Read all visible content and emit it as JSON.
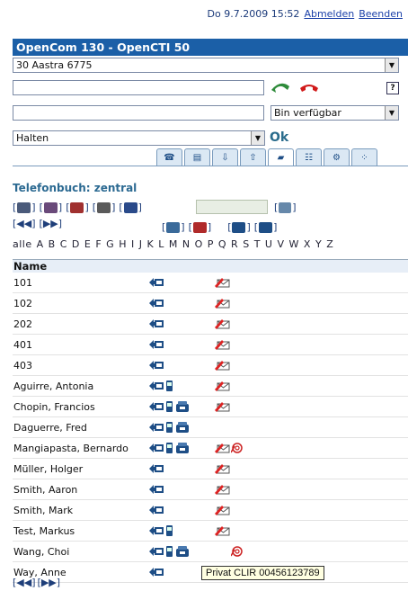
{
  "header": {
    "datetime": "Do 9.7.2009 15:52",
    "logout_label": "Abmelden",
    "exit_label": "Beenden"
  },
  "title": "OpenCom 130 - OpenCTI 50",
  "device_select": "30 Aastra 6775",
  "dial_input": "",
  "status_input": "",
  "status_select": "Bin verfügbar",
  "action_select": "Halten",
  "ok_label": "Ok",
  "phonebook_title": "Telefonbuch: zentral",
  "alphabet": [
    "alle",
    "A",
    "B",
    "C",
    "D",
    "E",
    "F",
    "G",
    "H",
    "I",
    "J",
    "K",
    "L",
    "M",
    "N",
    "O",
    "P",
    "Q",
    "R",
    "S",
    "T",
    "U",
    "V",
    "W",
    "X",
    "Y",
    "Z"
  ],
  "table_header": "Name",
  "rows": [
    {
      "name": "101",
      "card": true,
      "mobile": false,
      "desk": false,
      "mail": true,
      "at": false
    },
    {
      "name": "102",
      "card": true,
      "mobile": false,
      "desk": false,
      "mail": true,
      "at": false
    },
    {
      "name": "202",
      "card": true,
      "mobile": false,
      "desk": false,
      "mail": true,
      "at": false
    },
    {
      "name": "401",
      "card": true,
      "mobile": false,
      "desk": false,
      "mail": true,
      "at": false
    },
    {
      "name": "403",
      "card": true,
      "mobile": false,
      "desk": false,
      "mail": true,
      "at": false
    },
    {
      "name": "Aguirre, Antonia",
      "card": true,
      "mobile": true,
      "desk": false,
      "mail": true,
      "at": false
    },
    {
      "name": "Chopin, Francios",
      "card": true,
      "mobile": true,
      "desk": true,
      "mail": true,
      "at": false
    },
    {
      "name": "Daguerre, Fred",
      "card": true,
      "mobile": true,
      "desk": true,
      "mail": false,
      "at": false
    },
    {
      "name": "Mangiapasta, Bernardo",
      "card": true,
      "mobile": true,
      "desk": true,
      "mail": true,
      "at": true
    },
    {
      "name": "Müller, Holger",
      "card": true,
      "mobile": false,
      "desk": false,
      "mail": true,
      "at": false
    },
    {
      "name": "Smith, Aaron",
      "card": true,
      "mobile": false,
      "desk": false,
      "mail": true,
      "at": false
    },
    {
      "name": "Smith, Mark",
      "card": true,
      "mobile": false,
      "desk": false,
      "mail": true,
      "at": false
    },
    {
      "name": "Test, Markus",
      "card": true,
      "mobile": true,
      "desk": false,
      "mail": true,
      "at": false
    },
    {
      "name": "Wang, Choi",
      "card": true,
      "mobile": true,
      "desk": true,
      "mail": false,
      "at": true
    },
    {
      "name": "Way, Anne",
      "card": true,
      "mobile": false,
      "desk": false,
      "mail": true,
      "at": false
    }
  ],
  "tooltip": "Privat CLIR 00456123789"
}
